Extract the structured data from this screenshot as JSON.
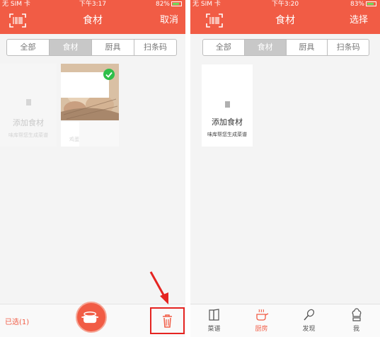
{
  "left": {
    "status": {
      "carrier": "无 SIM 卡",
      "time": "下午3:17",
      "battery": "82%"
    },
    "nav": {
      "title": "食材",
      "action": "取消"
    },
    "segments": [
      "全部",
      "食材",
      "厨具",
      "扫条码"
    ],
    "active_segment": 1,
    "add_card": {
      "title": "添加食材",
      "subtitle": "味库帮您生成菜谱"
    },
    "food_card": {
      "label": "鸡蛋",
      "selected": true
    },
    "bottom": {
      "selected_label": "已选(1)"
    }
  },
  "right": {
    "status": {
      "carrier": "无 SIM 卡",
      "time": "下午3:20",
      "battery": "83%"
    },
    "nav": {
      "title": "食材",
      "action": "选择"
    },
    "segments": [
      "全部",
      "食材",
      "厨具",
      "扫条码"
    ],
    "active_segment": 1,
    "add_card": {
      "title": "添加食材",
      "subtitle": "味库帮您生成菜谱"
    },
    "tabs": [
      {
        "label": "菜谱",
        "icon": "book-icon"
      },
      {
        "label": "厨房",
        "icon": "pot-icon"
      },
      {
        "label": "发现",
        "icon": "whisk-icon"
      },
      {
        "label": "我",
        "icon": "chef-icon"
      }
    ],
    "active_tab": 1
  },
  "colors": {
    "brand": "#f15c45",
    "annotation": "#e52421",
    "selected_check": "#2fbf4a",
    "background": "#f4f4f4",
    "segment_active": "#c8c8c8"
  }
}
